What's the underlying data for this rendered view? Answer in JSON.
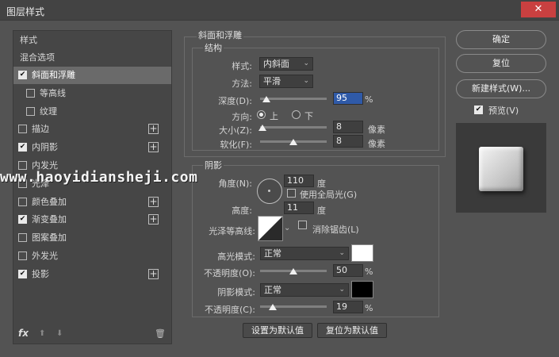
{
  "window": {
    "title": "图层样式",
    "close_glyph": "✕"
  },
  "left_panel": {
    "header": "样式",
    "blend_options": "混合选项",
    "items": [
      {
        "label": "斜面和浮雕",
        "checked": true,
        "selected": true,
        "plus": false,
        "indent": false
      },
      {
        "label": "等高线",
        "checked": false,
        "selected": false,
        "plus": false,
        "indent": true
      },
      {
        "label": "纹理",
        "checked": false,
        "selected": false,
        "plus": false,
        "indent": true
      },
      {
        "label": "描边",
        "checked": false,
        "selected": false,
        "plus": true,
        "indent": false
      },
      {
        "label": "内阴影",
        "checked": true,
        "selected": false,
        "plus": true,
        "indent": false
      },
      {
        "label": "内发光",
        "checked": false,
        "selected": false,
        "plus": false,
        "indent": false
      },
      {
        "label": "光泽",
        "checked": false,
        "selected": false,
        "plus": false,
        "indent": false
      },
      {
        "label": "颜色叠加",
        "checked": false,
        "selected": false,
        "plus": true,
        "indent": false
      },
      {
        "label": "渐变叠加",
        "checked": true,
        "selected": false,
        "plus": true,
        "indent": false
      },
      {
        "label": "图案叠加",
        "checked": false,
        "selected": false,
        "plus": false,
        "indent": false
      },
      {
        "label": "外发光",
        "checked": false,
        "selected": false,
        "plus": false,
        "indent": false
      },
      {
        "label": "投影",
        "checked": true,
        "selected": false,
        "plus": true,
        "indent": false
      }
    ],
    "fx_label": "fx",
    "check_glyph": "✔",
    "plus_glyph": "+",
    "up_glyph": "⬆",
    "down_glyph": "⬇",
    "trash_glyph": "🗑"
  },
  "bevel": {
    "group_title": "斜面和浮雕",
    "structure_title": "结构",
    "style_label": "样式:",
    "style_value": "内斜面",
    "method_label": "方法:",
    "method_value": "平滑",
    "depth_label": "深度(D):",
    "depth_value": "95",
    "depth_unit": "%",
    "depth_fraction": 0.095,
    "direction_label": "方向:",
    "direction_up": "上",
    "direction_down": "下",
    "size_label": "大小(Z):",
    "size_value": "8",
    "size_unit": "像素",
    "size_fraction": 0.03,
    "soften_label": "软化(F):",
    "soften_value": "8",
    "soften_unit": "像素",
    "soften_fraction": 0.5
  },
  "shading": {
    "title": "阴影",
    "angle_label": "角度(N):",
    "angle_value": "110",
    "angle_unit": "度",
    "global_light_label": "使用全局光(G)",
    "altitude_label": "高度:",
    "altitude_value": "11",
    "altitude_unit": "度",
    "gloss_label": "光泽等高线:",
    "antialias_label": "消除锯齿(L)",
    "highlight_mode_label": "高光模式:",
    "highlight_mode_value": "正常",
    "highlight_color": "#ffffff",
    "opacity1_label": "不透明度(O):",
    "opacity1_value": "50",
    "opacity1_unit": "%",
    "opacity1_fraction": 0.5,
    "shadow_mode_label": "阴影模式:",
    "shadow_mode_value": "正常",
    "shadow_color": "#000000",
    "opacity2_label": "不透明度(C):",
    "opacity2_value": "19",
    "opacity2_unit": "%",
    "opacity2_fraction": 0.19,
    "dropdown_glyph": "⌄"
  },
  "bottom_buttons": {
    "set_default": "设置为默认值",
    "reset_default": "复位为默认值"
  },
  "right_panel": {
    "ok": "确定",
    "reset": "复位",
    "new_style": "新建样式(W)...",
    "preview_label": "预览(V)",
    "preview_checked": true
  },
  "watermark": "www.haoyidiansheji.com"
}
